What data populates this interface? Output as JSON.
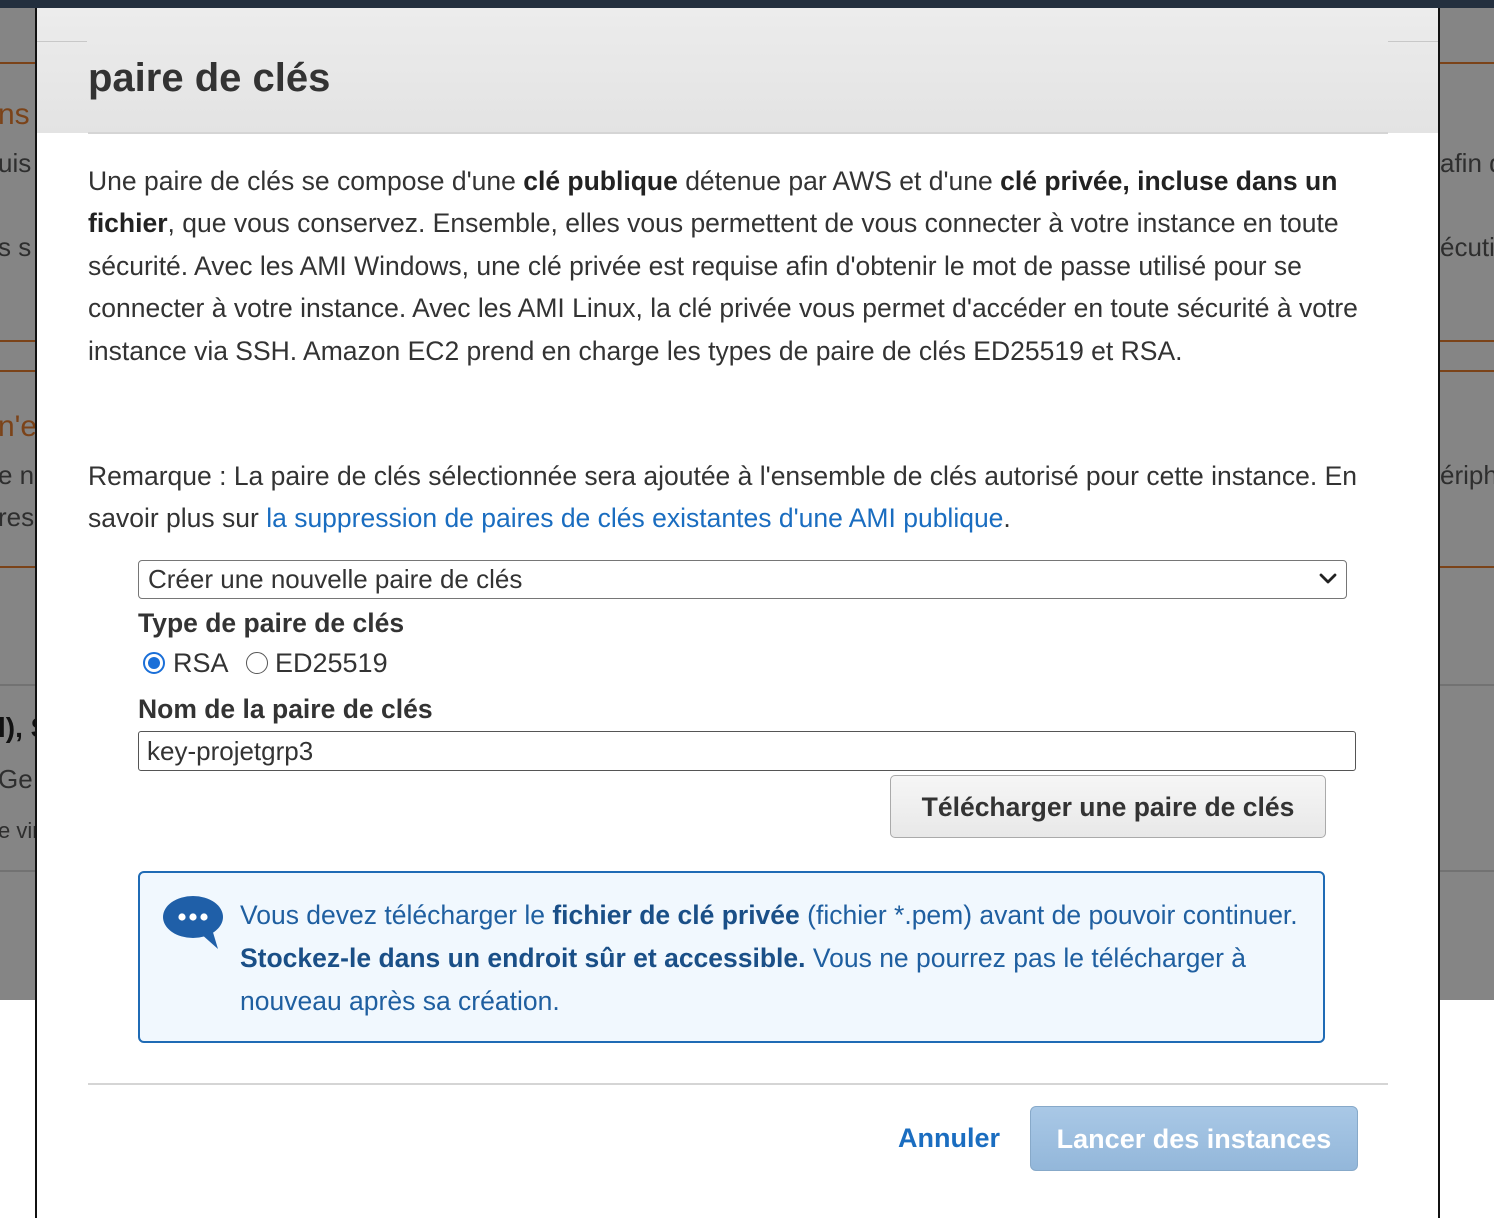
{
  "modal": {
    "title": "paire de clés",
    "intro": {
      "t1": "Une paire de clés se compose d'une ",
      "b1": "clé publique",
      "t2": " détenue par AWS et d'une ",
      "b2": "clé privée, incluse dans un fichier",
      "t3": ", que vous conservez. Ensemble, elles vous permettent de vous connecter à votre instance en toute sécurité. Avec les AMI Windows, une clé privée est requise afin d'obtenir le mot de passe utilisé pour se connecter à votre instance. Avec les AMI Linux, la clé privée vous permet d'accéder en toute sécurité à votre instance via SSH. Amazon EC2 prend en charge les types de paire de clés ED25519 et RSA."
    },
    "note": {
      "text": "Remarque : La paire de clés sélectionnée sera ajoutée à l'ensemble de clés autorisé pour cette instance. En savoir plus sur ",
      "link": "la suppression de paires de clés existantes d'une AMI publique",
      "end": "."
    },
    "keypair_select": {
      "selected": "Créer une nouvelle paire de clés"
    },
    "key_type": {
      "label": "Type de paire de clés",
      "options": [
        "RSA",
        "ED25519"
      ],
      "selected": "RSA"
    },
    "key_name": {
      "label": "Nom de la paire de clés",
      "value": "key-projetgrp3"
    },
    "download_button": "Télécharger une paire de clés",
    "info": {
      "t1": "Vous devez télécharger le ",
      "b1": "fichier de clé privée",
      "t2": " (fichier *.pem) avant de pouvoir continuer. ",
      "b2": "Stockez-le dans un endroit sûr et accessible.",
      "t3": " Vous ne pourrez pas le télécharger à nouveau après sa création."
    },
    "cancel_button": "Annuler",
    "launch_button": "Lancer des instances"
  },
  "background": {
    "left_fragments": [
      "ns",
      "uis",
      "s s",
      "n'e",
      "e n",
      "res",
      "l), S",
      "Ge",
      "e vir"
    ],
    "right_fragments": [
      "afin d",
      "écutio",
      "ériph"
    ]
  },
  "colors": {
    "link": "#1a6dc0",
    "info_border": "#1f6bb5",
    "info_bg": "#f1f8fe",
    "launch_bg": "#9bbde0",
    "accent_orange": "#e07a2e",
    "topbar": "#232f3e"
  }
}
